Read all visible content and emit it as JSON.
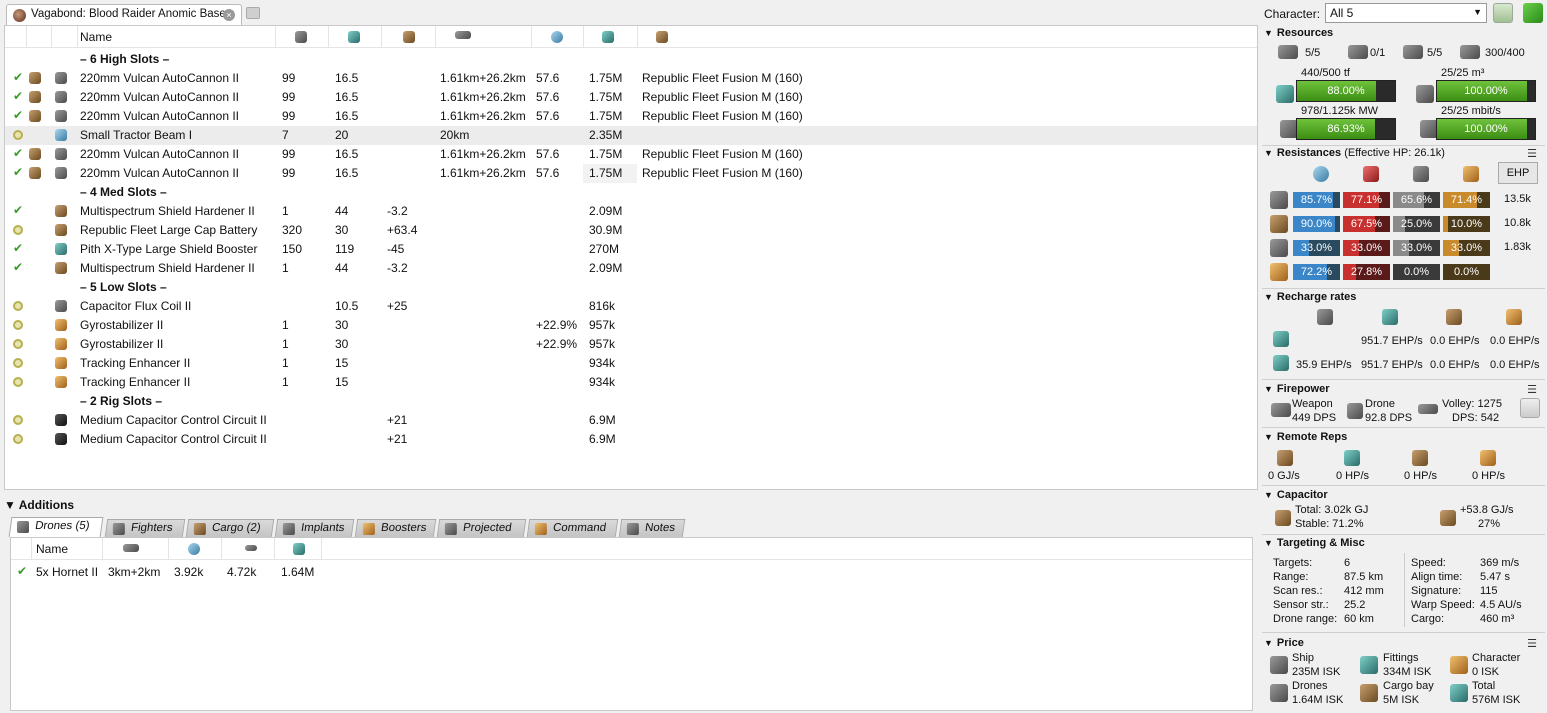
{
  "tab": {
    "title": "Vagabond: Blood Raider Anomic Base"
  },
  "fitting": {
    "columns": {
      "name": "Name"
    },
    "rows": [
      {
        "kind": "header",
        "name": "– 6 High Slots –"
      },
      {
        "kind": "module",
        "state": "active",
        "charge_icon": true,
        "icon": "autocannon-icon",
        "name": "220mm Vulcan AutoCannon II",
        "c1": "99",
        "c2": "16.5",
        "c3": "",
        "range": "1.61km+26.2km",
        "c5": "57.6",
        "price": "1.75M",
        "ammo": "Republic Fleet Fusion M (160)"
      },
      {
        "kind": "module",
        "state": "active",
        "charge_icon": true,
        "icon": "autocannon-icon",
        "name": "220mm Vulcan AutoCannon II",
        "c1": "99",
        "c2": "16.5",
        "c3": "",
        "range": "1.61km+26.2km",
        "c5": "57.6",
        "price": "1.75M",
        "ammo": "Republic Fleet Fusion M (160)"
      },
      {
        "kind": "module",
        "state": "active",
        "charge_icon": true,
        "icon": "autocannon-icon",
        "name": "220mm Vulcan AutoCannon II",
        "c1": "99",
        "c2": "16.5",
        "c3": "",
        "range": "1.61km+26.2km",
        "c5": "57.6",
        "price": "1.75M",
        "ammo": "Republic Fleet Fusion M (160)"
      },
      {
        "kind": "module",
        "state": "online",
        "charge_icon": false,
        "icon": "tractor-beam-icon",
        "name": "Small Tractor Beam I",
        "c1": "7",
        "c2": "20",
        "c3": "",
        "range": "20km",
        "c5": "",
        "price": "2.35M",
        "ammo": "",
        "selected": true
      },
      {
        "kind": "module",
        "state": "active",
        "charge_icon": true,
        "icon": "autocannon-icon",
        "name": "220mm Vulcan AutoCannon II",
        "c1": "99",
        "c2": "16.5",
        "c3": "",
        "range": "1.61km+26.2km",
        "c5": "57.6",
        "price": "1.75M",
        "ammo": "Republic Fleet Fusion M (160)"
      },
      {
        "kind": "module",
        "state": "active",
        "charge_icon": true,
        "icon": "autocannon-icon",
        "name": "220mm Vulcan AutoCannon II",
        "c1": "99",
        "c2": "16.5",
        "c3": "",
        "range": "1.61km+26.2km",
        "c5": "57.6",
        "price": "1.75M",
        "ammo": "Republic Fleet Fusion M (160)",
        "price_hl": true
      },
      {
        "kind": "header",
        "name": "– 4 Med Slots –"
      },
      {
        "kind": "module",
        "state": "active",
        "charge_icon": false,
        "icon": "shield-hardener-icon",
        "name": "Multispectrum Shield Hardener II",
        "c1": "1",
        "c2": "44",
        "c3": "-3.2",
        "range": "",
        "c5": "",
        "price": "2.09M",
        "ammo": ""
      },
      {
        "kind": "module",
        "state": "online",
        "charge_icon": false,
        "icon": "cap-battery-icon",
        "name": "Republic Fleet Large Cap Battery",
        "c1": "320",
        "c2": "30",
        "c3": "+63.4",
        "range": "",
        "c5": "",
        "price": "30.9M",
        "ammo": ""
      },
      {
        "kind": "module",
        "state": "active",
        "charge_icon": false,
        "icon": "shield-booster-icon",
        "name": "Pith X-Type Large Shield Booster",
        "c1": "150",
        "c2": "119",
        "c3": "-45",
        "range": "",
        "c5": "",
        "price": "270M",
        "ammo": ""
      },
      {
        "kind": "module",
        "state": "active",
        "charge_icon": false,
        "icon": "shield-hardener-icon",
        "name": "Multispectrum Shield Hardener II",
        "c1": "1",
        "c2": "44",
        "c3": "-3.2",
        "range": "",
        "c5": "",
        "price": "2.09M",
        "ammo": ""
      },
      {
        "kind": "header",
        "name": "– 5 Low Slots –"
      },
      {
        "kind": "module",
        "state": "online",
        "charge_icon": false,
        "icon": "cap-flux-coil-icon",
        "name": "Capacitor Flux Coil II",
        "c1": "",
        "c2": "10.5",
        "c3": "+25",
        "range": "",
        "c5": "",
        "price": "816k",
        "ammo": ""
      },
      {
        "kind": "module",
        "state": "online",
        "charge_icon": false,
        "icon": "gyrostabilizer-icon",
        "name": "Gyrostabilizer II",
        "c1": "1",
        "c2": "30",
        "c3": "",
        "range": "",
        "c5": "+22.9%",
        "price": "957k",
        "ammo": ""
      },
      {
        "kind": "module",
        "state": "online",
        "charge_icon": false,
        "icon": "gyrostabilizer-icon",
        "name": "Gyrostabilizer II",
        "c1": "1",
        "c2": "30",
        "c3": "",
        "range": "",
        "c5": "+22.9%",
        "price": "957k",
        "ammo": ""
      },
      {
        "kind": "module",
        "state": "online",
        "charge_icon": false,
        "icon": "tracking-enhancer-icon",
        "name": "Tracking Enhancer II",
        "c1": "1",
        "c2": "15",
        "c3": "",
        "range": "",
        "c5": "",
        "price": "934k",
        "ammo": ""
      },
      {
        "kind": "module",
        "state": "online",
        "charge_icon": false,
        "icon": "tracking-enhancer-icon",
        "name": "Tracking Enhancer II",
        "c1": "1",
        "c2": "15",
        "c3": "",
        "range": "",
        "c5": "",
        "price": "934k",
        "ammo": ""
      },
      {
        "kind": "header",
        "name": "– 2 Rig Slots –"
      },
      {
        "kind": "module",
        "state": "online",
        "charge_icon": false,
        "icon": "rig-icon",
        "name": "Medium Capacitor Control Circuit II",
        "c1": "",
        "c2": "",
        "c3": "+21",
        "range": "",
        "c5": "",
        "price": "6.9M",
        "ammo": ""
      },
      {
        "kind": "module",
        "state": "online",
        "charge_icon": false,
        "icon": "rig-icon",
        "name": "Medium Capacitor Control Circuit II",
        "c1": "",
        "c2": "",
        "c3": "+21",
        "range": "",
        "c5": "",
        "price": "6.9M",
        "ammo": ""
      }
    ]
  },
  "additions": {
    "title": "Additions",
    "tabs": [
      "Drones (5)",
      "Fighters",
      "Cargo (2)",
      "Implants",
      "Boosters",
      "Projected",
      "Command",
      "Notes"
    ],
    "drone_header": {
      "name": "Name"
    },
    "drones": [
      {
        "name": "5x Hornet II",
        "range": "3km+2km",
        "c2": "3.92k",
        "c3": "4.72k",
        "price": "1.64M"
      }
    ]
  },
  "stats": {
    "character": {
      "label": "Character:",
      "value": "All 5"
    },
    "resources": {
      "title": "Resources",
      "hardpoints": [
        {
          "icon": "turret-hardpoint-icon",
          "value": "5/5"
        },
        {
          "icon": "launcher-hardpoint-icon",
          "value": "0/1"
        },
        {
          "icon": "drone-count-icon",
          "value": "5/5"
        },
        {
          "icon": "drone-bay-icon",
          "value": "300/400"
        }
      ],
      "bars": [
        {
          "icon": "cpu-icon",
          "caption": "440/500 tf",
          "pct": "88.00%",
          "fraction": 0.88
        },
        {
          "icon": "drone-bandwidth-icon",
          "caption": "25/25 m³",
          "pct": "100.00%",
          "fraction": 1.0
        },
        {
          "icon": "powergrid-icon",
          "caption": "978/1.125k MW",
          "pct": "86.93%",
          "fraction": 0.8693
        },
        {
          "icon": "drone-control-icon",
          "caption": "25/25 mbit/s",
          "pct": "100.00%",
          "fraction": 1.0
        }
      ]
    },
    "resistances": {
      "title": "Resistances",
      "effective_hp": "(Effective HP: 26.1k)",
      "ehp_button": "EHP",
      "rows": [
        {
          "icon": "shield-icon",
          "em": "85.7%",
          "th": "77.1%",
          "ki": "65.6%",
          "ex": "71.4%",
          "f": [
            0.857,
            0.771,
            0.656,
            0.714
          ],
          "hp": "13.5k"
        },
        {
          "icon": "armor-icon",
          "em": "90.0%",
          "th": "67.5%",
          "ki": "25.0%",
          "ex": "10.0%",
          "f": [
            0.9,
            0.675,
            0.25,
            0.1
          ],
          "hp": "10.8k"
        },
        {
          "icon": "hull-icon",
          "em": "33.0%",
          "th": "33.0%",
          "ki": "33.0%",
          "ex": "33.0%",
          "f": [
            0.33,
            0.33,
            0.33,
            0.33
          ],
          "hp": "1.83k"
        },
        {
          "icon": "damage-pattern-icon",
          "em": "72.2%",
          "th": "27.8%",
          "ki": "0.0%",
          "ex": "0.0%",
          "f": [
            0.722,
            0.278,
            0.0,
            0.0
          ],
          "hp": ""
        }
      ]
    },
    "recharge": {
      "title": "Recharge rates",
      "row1": [
        "951.7 EHP/s",
        "0.0 EHP/s",
        "0.0 EHP/s"
      ],
      "row2": [
        "35.9 EHP/s",
        "951.7 EHP/s",
        "0.0 EHP/s",
        "0.0 EHP/s"
      ]
    },
    "firepower": {
      "title": "Firepower",
      "weapon_label": "Weapon",
      "weapon_dps": "449 DPS",
      "drone_label": "Drone",
      "drone_dps": "92.8 DPS",
      "volley": "Volley: 1275",
      "dps": "DPS: 542"
    },
    "remote_reps": {
      "title": "Remote Reps",
      "values": [
        "0 GJ/s",
        "0 HP/s",
        "0 HP/s",
        "0 HP/s"
      ]
    },
    "capacitor": {
      "title": "Capacitor",
      "total": "Total: 3.02k GJ",
      "stable": "Stable: 71.2%",
      "rate": "+53.8 GJ/s",
      "rate_pct": "27%"
    },
    "targeting": {
      "title": "Targeting & Misc",
      "left": [
        {
          "label": "Targets:",
          "value": "6"
        },
        {
          "label": "Range:",
          "value": "87.5 km"
        },
        {
          "label": "Scan res.:",
          "value": "412 mm"
        },
        {
          "label": "Sensor str.:",
          "value": "25.2"
        },
        {
          "label": "Drone range:",
          "value": "60 km"
        }
      ],
      "right": [
        {
          "label": "Speed:",
          "value": "369 m/s"
        },
        {
          "label": "Align time:",
          "value": "5.47 s"
        },
        {
          "label": "Signature:",
          "value": "115"
        },
        {
          "label": "Warp Speed:",
          "value": "4.5 AU/s"
        },
        {
          "label": "Cargo:",
          "value": "460 m³"
        }
      ]
    },
    "price": {
      "title": "Price",
      "items": [
        {
          "label": "Ship",
          "value": "235M ISK"
        },
        {
          "label": "Fittings",
          "value": "334M ISK"
        },
        {
          "label": "Character",
          "value": "0 ISK"
        },
        {
          "label": "Drones",
          "value": "1.64M ISK"
        },
        {
          "label": "Cargo bay",
          "value": "5M ISK"
        },
        {
          "label": "Total",
          "value": "576M ISK"
        }
      ]
    }
  }
}
